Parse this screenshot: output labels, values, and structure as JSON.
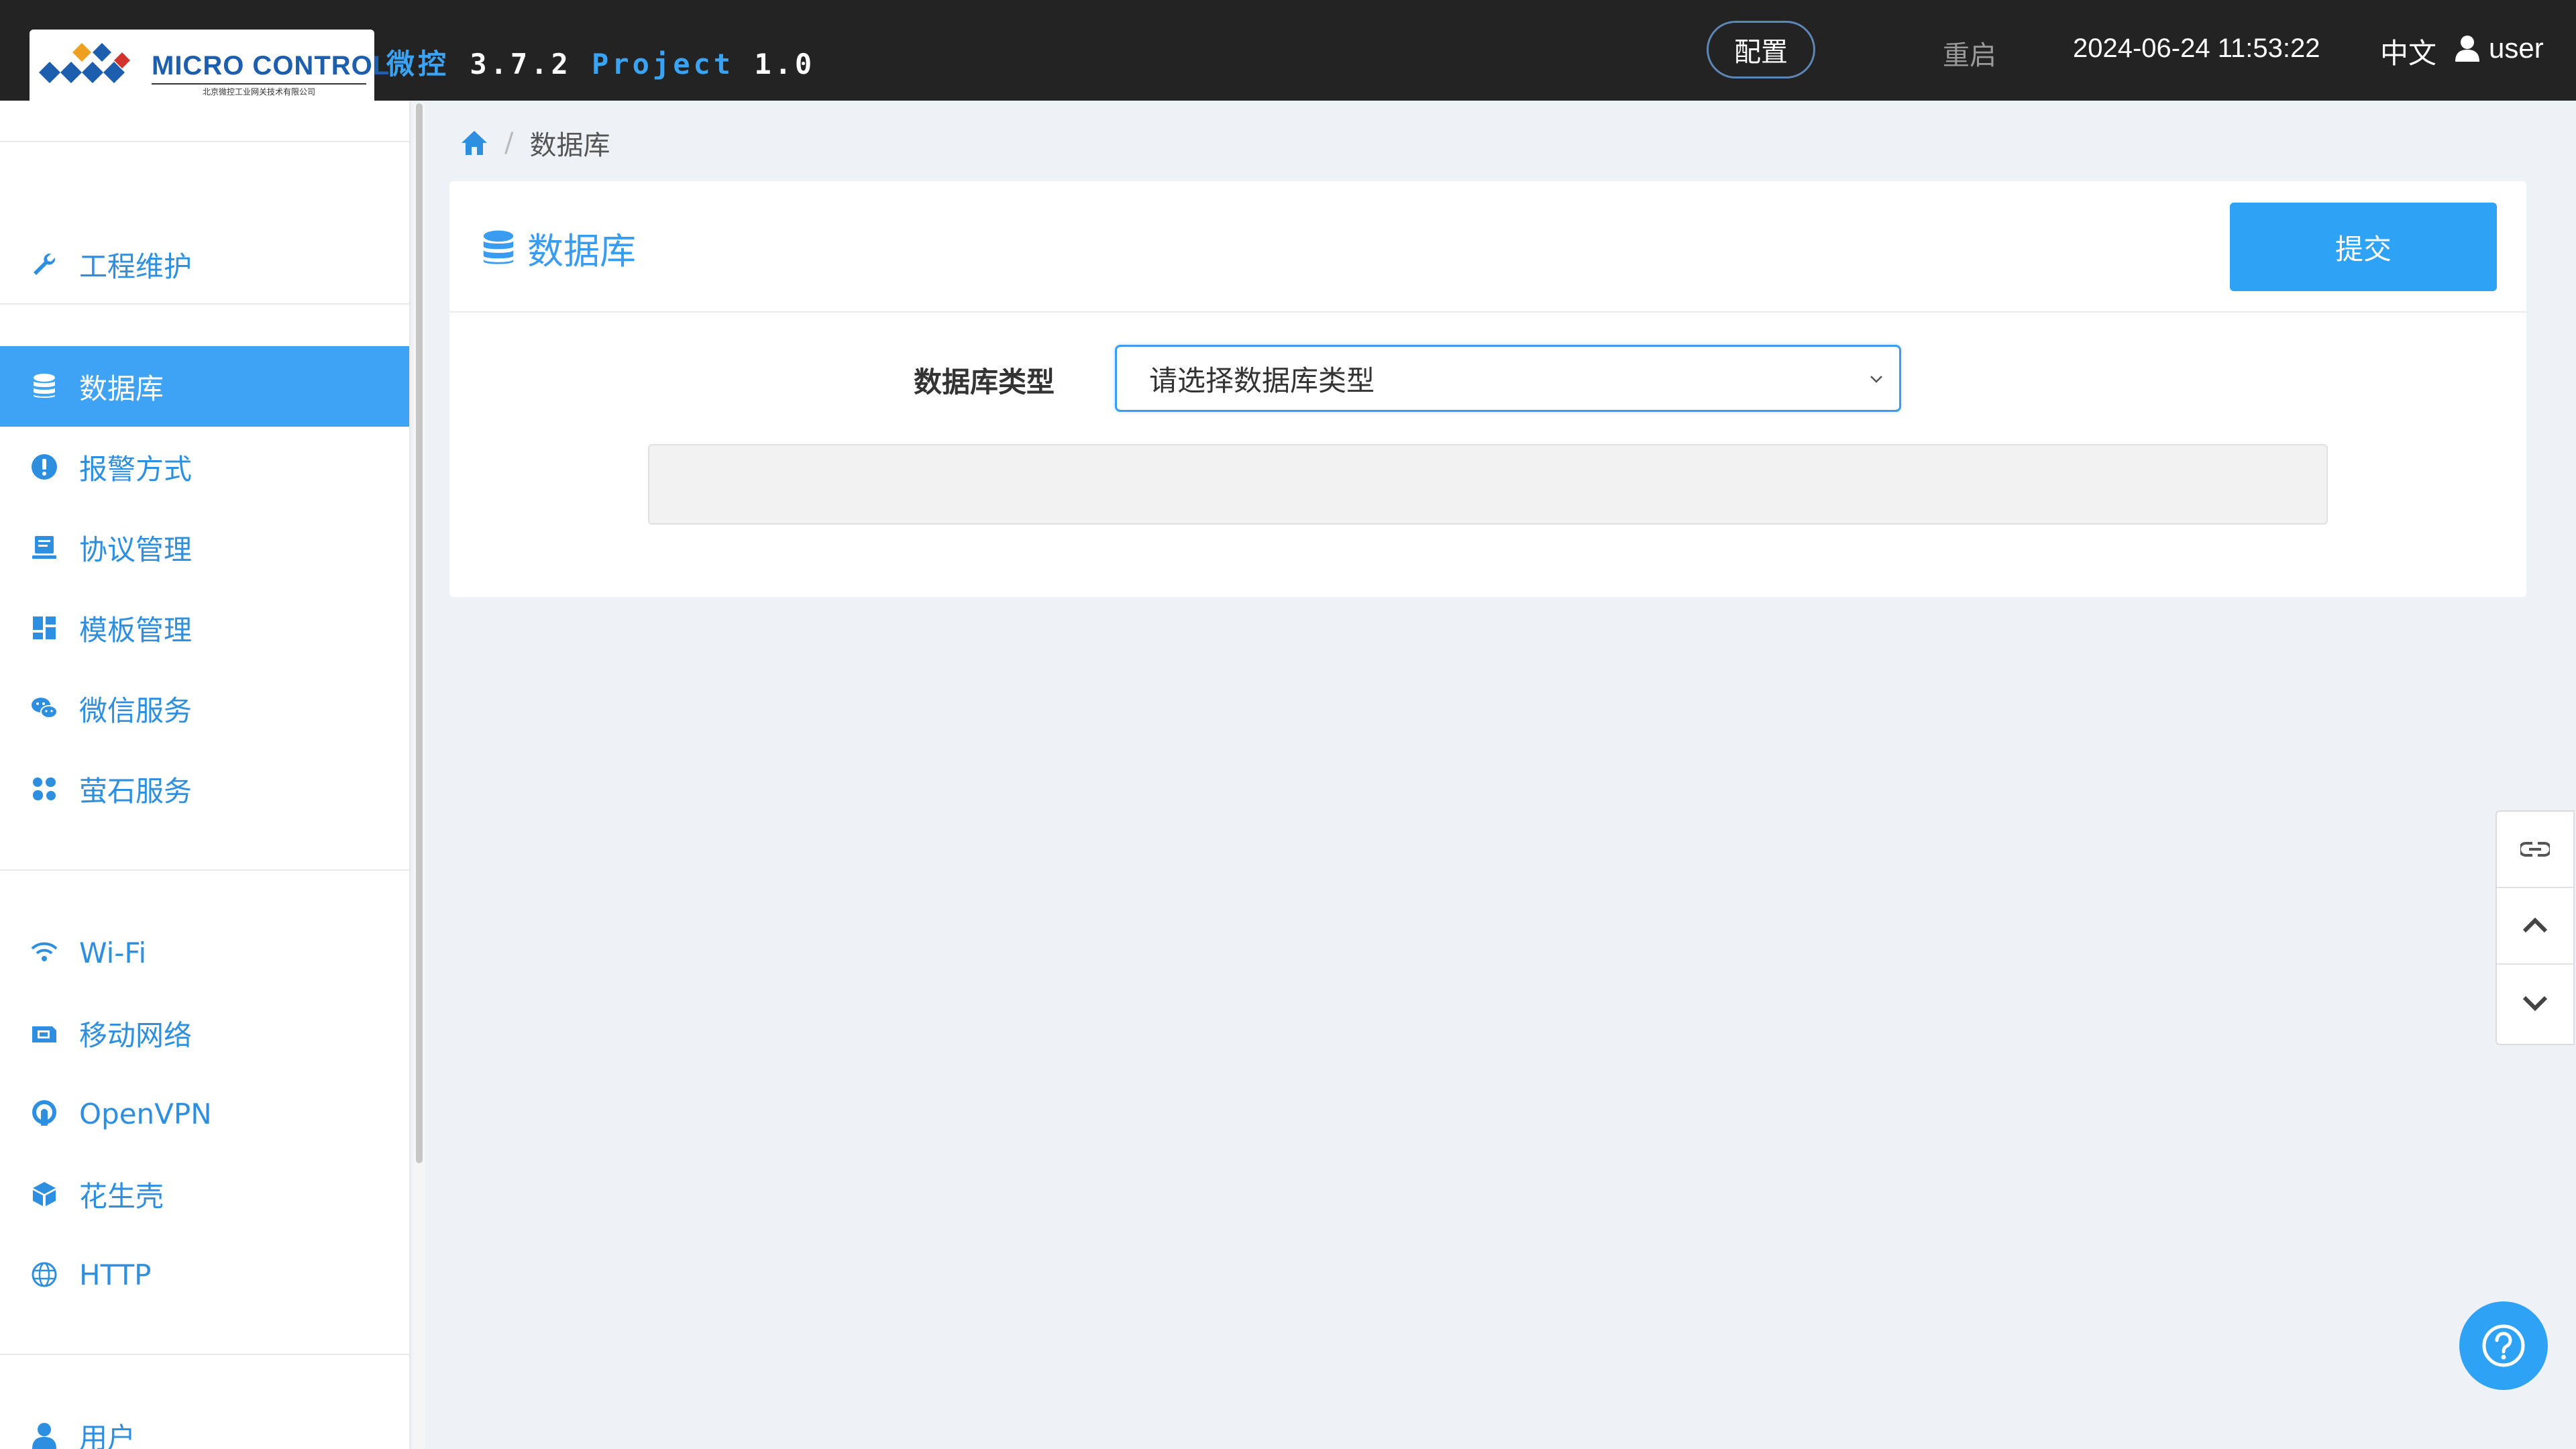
{
  "header": {
    "logo_text": "MICRO CONTROL",
    "logo_subtitle": "北京微控工业网关技术有限公司",
    "title_brand": "微控",
    "title_version": "3.7.2",
    "title_project_label": "Project",
    "title_project_version": "1.0",
    "config_label": "配置",
    "restart_label": "重启",
    "datetime": "2024-06-24 11:53:22",
    "language": "中文",
    "username": "user"
  },
  "sidebar": {
    "items": [
      {
        "label": "工程维护",
        "icon": "wrench-icon"
      },
      {
        "label": "数据库",
        "icon": "database-icon",
        "active": true
      },
      {
        "label": "报警方式",
        "icon": "alert-icon"
      },
      {
        "label": "协议管理",
        "icon": "protocol-icon"
      },
      {
        "label": "模板管理",
        "icon": "template-icon"
      },
      {
        "label": "微信服务",
        "icon": "wechat-icon"
      },
      {
        "label": "萤石服务",
        "icon": "ezviz-icon"
      },
      {
        "label": "Wi-Fi",
        "icon": "wifi-icon"
      },
      {
        "label": "移动网络",
        "icon": "sim-card-icon"
      },
      {
        "label": "OpenVPN",
        "icon": "openvpn-icon"
      },
      {
        "label": "花生壳",
        "icon": "cube-icon"
      },
      {
        "label": "HTTP",
        "icon": "globe-icon"
      },
      {
        "label": "用户",
        "icon": "user-icon"
      }
    ]
  },
  "breadcrumb": {
    "current": "数据库"
  },
  "main": {
    "card_title": "数据库",
    "submit_label": "提交",
    "form": {
      "db_type_label": "数据库类型",
      "db_type_placeholder": "请选择数据库类型"
    }
  },
  "colors": {
    "accent": "#3ea3f5",
    "topbar": "#232323",
    "background": "#eef2f6"
  }
}
